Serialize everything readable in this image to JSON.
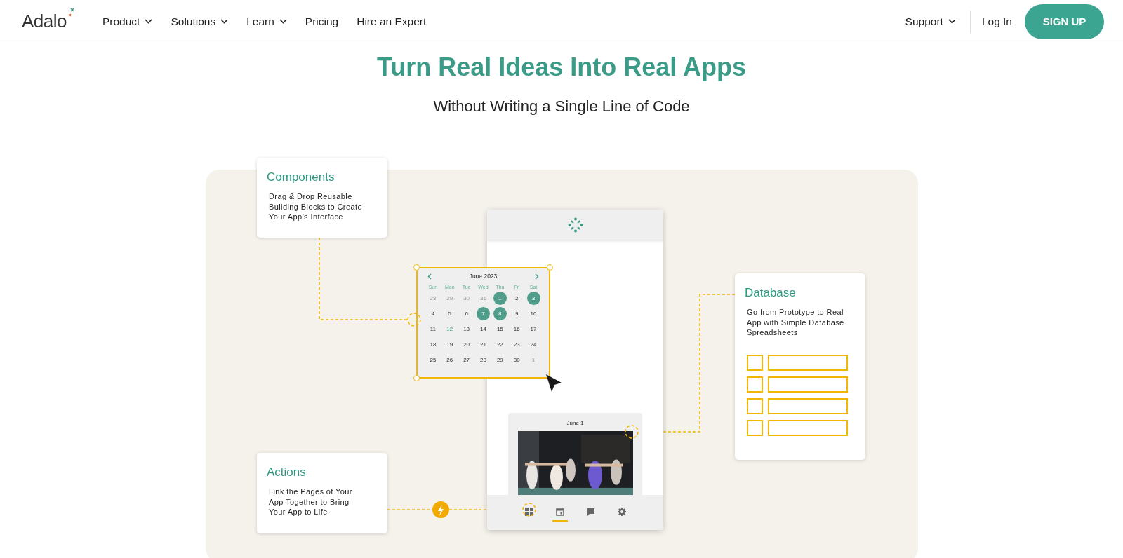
{
  "header": {
    "logo": "Adalo",
    "nav": [
      {
        "label": "Product",
        "has_menu": true
      },
      {
        "label": "Solutions",
        "has_menu": true
      },
      {
        "label": "Learn",
        "has_menu": true
      },
      {
        "label": "Pricing",
        "has_menu": false
      },
      {
        "label": "Hire an Expert",
        "has_menu": false
      }
    ],
    "support": {
      "label": "Support",
      "has_menu": true
    },
    "login": "Log In",
    "signup": "SIGN UP"
  },
  "hero": {
    "title": "Turn Real Ideas Into Real Apps",
    "subtitle": "Without Writing a Single Line of Code"
  },
  "cards": [
    {
      "kind": "components",
      "title": "Components",
      "text": "Drag & Drop Reusable Building Blocks to Create Your App’s Interface"
    },
    {
      "kind": "database",
      "title": "Database",
      "text": "Go from Prototype to Real App with Simple Database Spreadsheets"
    },
    {
      "kind": "actions",
      "title": "Actions",
      "text": "Link the Pages of Your App Together to Bring Your App to Life"
    }
  ],
  "calendar": {
    "month": "June 2023",
    "weekdays": [
      "Sun",
      "Mon",
      "Tue",
      "Wed",
      "Thu",
      "Fri",
      "Sat"
    ],
    "days": [
      {
        "day": "28",
        "kind": "other"
      },
      {
        "day": "29",
        "kind": "other"
      },
      {
        "day": "30",
        "kind": "other"
      },
      {
        "day": "31",
        "kind": "other"
      },
      {
        "day": "1",
        "kind": "selected"
      },
      {
        "day": "2",
        "kind": "normal"
      },
      {
        "day": "3",
        "kind": "selected"
      },
      {
        "day": "4",
        "kind": "normal"
      },
      {
        "day": "5",
        "kind": "normal"
      },
      {
        "day": "6",
        "kind": "normal"
      },
      {
        "day": "7",
        "kind": "selected"
      },
      {
        "day": "8",
        "kind": "selected"
      },
      {
        "day": "9",
        "kind": "normal"
      },
      {
        "day": "10",
        "kind": "normal"
      },
      {
        "day": "11",
        "kind": "normal"
      },
      {
        "day": "12",
        "kind": "today"
      },
      {
        "day": "13",
        "kind": "normal"
      },
      {
        "day": "14",
        "kind": "normal"
      },
      {
        "day": "15",
        "kind": "normal"
      },
      {
        "day": "16",
        "kind": "normal"
      },
      {
        "day": "17",
        "kind": "normal"
      },
      {
        "day": "18",
        "kind": "normal"
      },
      {
        "day": "19",
        "kind": "normal"
      },
      {
        "day": "20",
        "kind": "normal"
      },
      {
        "day": "21",
        "kind": "normal"
      },
      {
        "day": "22",
        "kind": "normal"
      },
      {
        "day": "23",
        "kind": "normal"
      },
      {
        "day": "24",
        "kind": "normal"
      },
      {
        "day": "25",
        "kind": "normal"
      },
      {
        "day": "26",
        "kind": "normal"
      },
      {
        "day": "27",
        "kind": "normal"
      },
      {
        "day": "28",
        "kind": "normal"
      },
      {
        "day": "29",
        "kind": "normal"
      },
      {
        "day": "30",
        "kind": "normal"
      },
      {
        "day": "1",
        "kind": "other"
      }
    ]
  },
  "phone": {
    "event": {
      "title": "June 1"
    },
    "tabs": [
      {
        "kind": "grid",
        "selected": false
      },
      {
        "kind": "calendar",
        "selected": true
      },
      {
        "kind": "chat",
        "selected": false
      },
      {
        "kind": "settings",
        "selected": false
      }
    ]
  }
}
